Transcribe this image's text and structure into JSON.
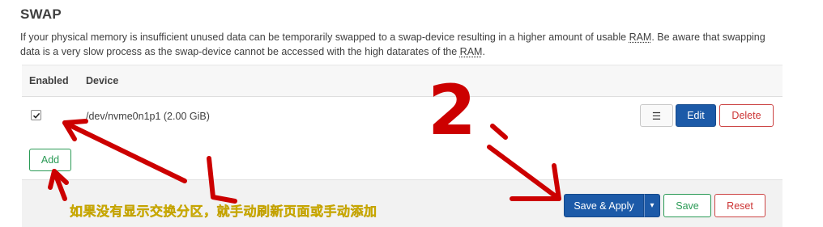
{
  "section": {
    "title": "SWAP",
    "desc_part1": "If your physical memory is insufficient unused data can be temporarily swapped to a swap-device resulting in a higher amount of usable ",
    "abbr_ram": "RAM",
    "desc_part2": ". Be aware that swapping data is a very slow process as the swap-device cannot be accessed with the high datarates of the ",
    "desc_part3": "."
  },
  "table": {
    "headers": {
      "enabled": "Enabled",
      "device": "Device"
    },
    "row": {
      "enabled": true,
      "device": "/dev/nvme0n1p1 (2.00 GiB)",
      "menu_icon": "☰",
      "edit_label": "Edit",
      "delete_label": "Delete"
    },
    "add_label": "Add"
  },
  "footer": {
    "save_apply_label": "Save & Apply",
    "dropdown_caret": "▾",
    "save_label": "Save",
    "reset_label": "Reset"
  },
  "annotation": {
    "step_number": "2",
    "note": "如果没有显示交换分区，就手动刷新页面或手动添加",
    "color": "#f6e600",
    "arrow_color": "#cc0000"
  },
  "colors": {
    "primary": "#1c5aa8",
    "positive": "#2a9a55",
    "negative": "#cc3333"
  }
}
